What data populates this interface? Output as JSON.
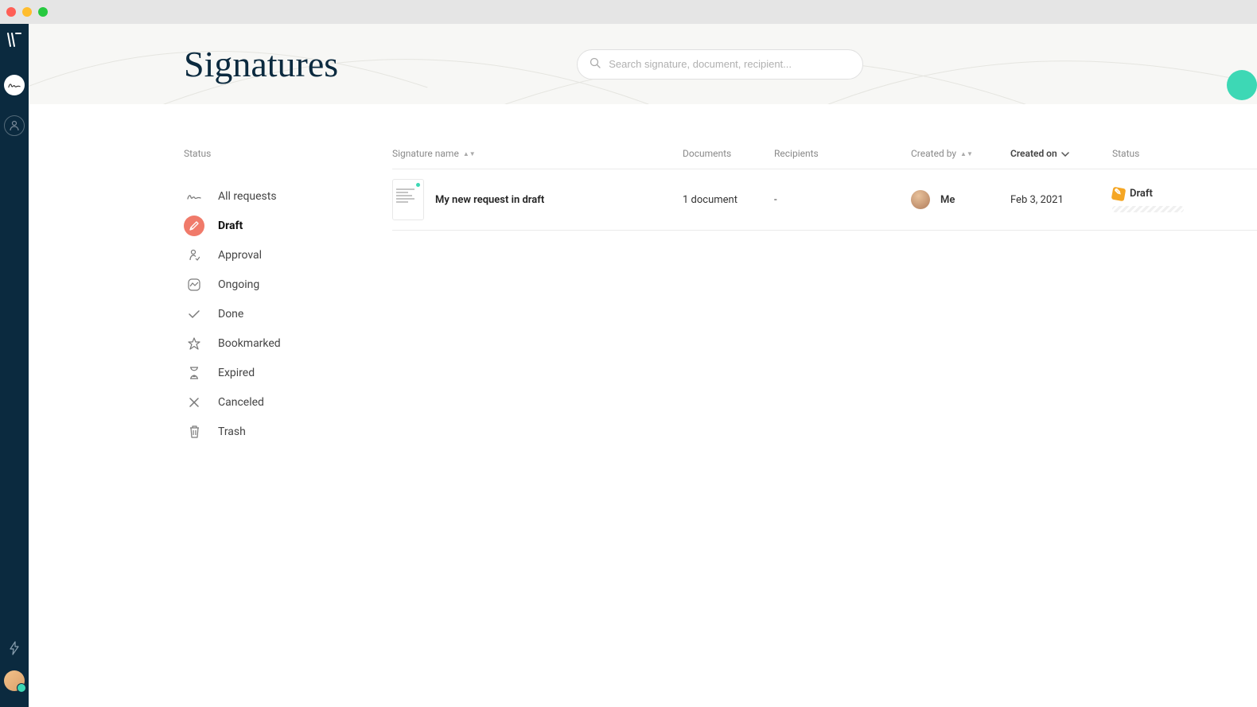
{
  "page": {
    "title": "Signatures"
  },
  "search": {
    "placeholder": "Search signature, document, recipient..."
  },
  "sidebar": {
    "title": "Status",
    "filters": [
      {
        "label": "All requests",
        "icon": "signature",
        "active": false
      },
      {
        "label": "Draft",
        "icon": "pencil",
        "active": true
      },
      {
        "label": "Approval",
        "icon": "person-approve",
        "active": false
      },
      {
        "label": "Ongoing",
        "icon": "progress",
        "active": false
      },
      {
        "label": "Done",
        "icon": "check",
        "active": false
      },
      {
        "label": "Bookmarked",
        "icon": "star",
        "active": false
      },
      {
        "label": "Expired",
        "icon": "hourglass",
        "active": false
      },
      {
        "label": "Canceled",
        "icon": "close",
        "active": false
      },
      {
        "label": "Trash",
        "icon": "trash",
        "active": false
      }
    ]
  },
  "table": {
    "columns": {
      "name": "Signature name",
      "documents": "Documents",
      "recipients": "Recipients",
      "created_by": "Created by",
      "created_on": "Created on",
      "status": "Status"
    },
    "rows": [
      {
        "name": "My new request in draft",
        "documents": "1 document",
        "recipients": "-",
        "created_by": "Me",
        "created_on": "Feb 3, 2021",
        "status": "Draft"
      }
    ]
  },
  "colors": {
    "rail": "#0b2a3f",
    "accent": "#3dd8b5",
    "filter_active_bg": "#f07a6a",
    "status_draft": "#f5a623"
  }
}
